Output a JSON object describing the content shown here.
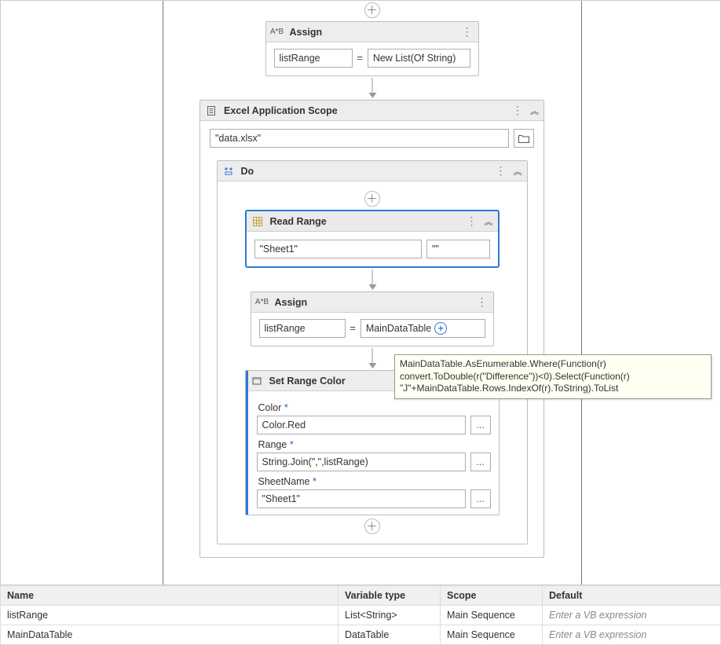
{
  "assign1": {
    "title": "Assign",
    "ab": "A*B",
    "lhs": "listRange",
    "eq": "=",
    "rhs": "New List(Of String)"
  },
  "scope": {
    "title": "Excel Application Scope",
    "file": "\"data.xlsx\""
  },
  "do": {
    "title": "Do"
  },
  "readRange": {
    "title": "Read Range",
    "sheet": "\"Sheet1\"",
    "range": "\"\""
  },
  "assign2": {
    "title": "Assign",
    "ab": "A*B",
    "lhs": "listRange",
    "eq": "=",
    "rhs": "MainDataTable"
  },
  "tooltip": "MainDataTable.AsEnumerable.Where(Function(r) convert.ToDouble(r(\"Difference\"))<0).Select(Function(r) \"J\"+MainDataTable.Rows.IndexOf(r).ToString).ToList",
  "setRange": {
    "title": "Set Range Color",
    "colorLabel": "Color",
    "colorValue": "Color.Red",
    "rangeLabel": "Range",
    "rangeValue": "String.Join(\",\",listRange)",
    "sheetLabel": "SheetName",
    "sheetValue": "\"Sheet1\"",
    "star": "*",
    "ellipsis": "..."
  },
  "addBtn": "+",
  "variables": {
    "headers": [
      "Name",
      "Variable type",
      "Scope",
      "Default"
    ],
    "rows": [
      {
        "name": "listRange",
        "type": "List<String>",
        "scope": "Main Sequence",
        "default": "Enter a VB expression"
      },
      {
        "name": "MainDataTable",
        "type": "DataTable",
        "scope": "Main Sequence",
        "default": "Enter a VB expression"
      }
    ]
  }
}
